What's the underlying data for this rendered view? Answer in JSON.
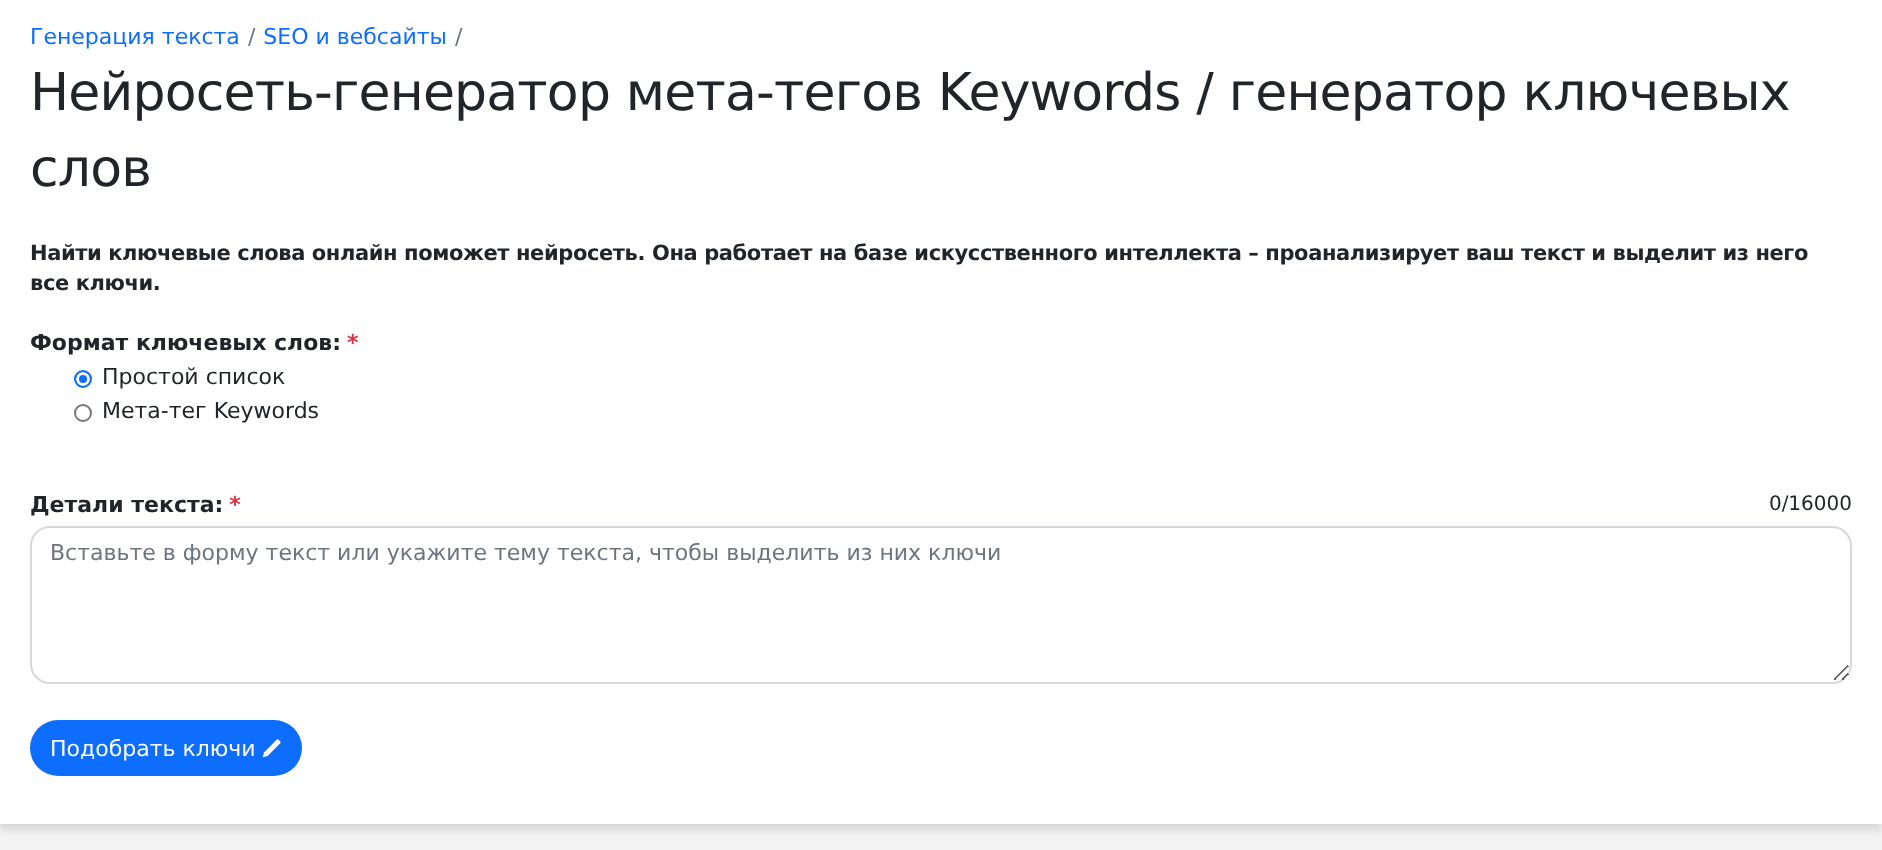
{
  "breadcrumbs": [
    {
      "label": "Генерация текста",
      "separator": "/"
    },
    {
      "label": "SEO и вебсайты",
      "separator": "/"
    }
  ],
  "title": "Нейросеть-генератор мета-тегов Keywords / генератор ключевых слов",
  "description": "Найти ключевые слова онлайн поможет нейросеть. Она работает на базе искусственного интеллекта – проанализирует ваш текст и выделит из него все ключи.",
  "format": {
    "label": "Формат ключевых слов:",
    "required_mark": "*",
    "options": [
      {
        "label": "Простой список",
        "selected": true
      },
      {
        "label": "Мета-тег Keywords",
        "selected": false
      }
    ]
  },
  "details": {
    "label": "Детали текста:",
    "required_mark": "*",
    "counter": "0/16000",
    "placeholder": "Вставьте в форму текст или укажите тему текста, чтобы выделить из них ключи"
  },
  "submit": {
    "label": "Подобрать ключи"
  }
}
